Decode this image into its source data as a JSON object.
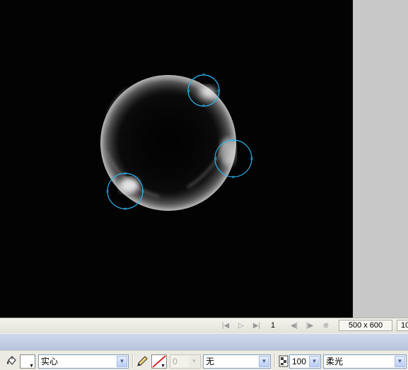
{
  "stage": {
    "background": "#030303",
    "artwork": "bubble",
    "selection_color": "#2bb3f0"
  },
  "statusbar": {
    "icons": [
      "first-frame-icon",
      "play-icon",
      "last-frame-icon",
      "prev-frame-icon",
      "next-frame-icon",
      "stop-icon"
    ],
    "frame": "1",
    "size": "500 x 600",
    "zoom": "10"
  },
  "properties": {
    "fill_style": "实心",
    "stroke_width": "0",
    "stroke_style": "无",
    "opacity": "100",
    "blend_mode": "柔光"
  }
}
